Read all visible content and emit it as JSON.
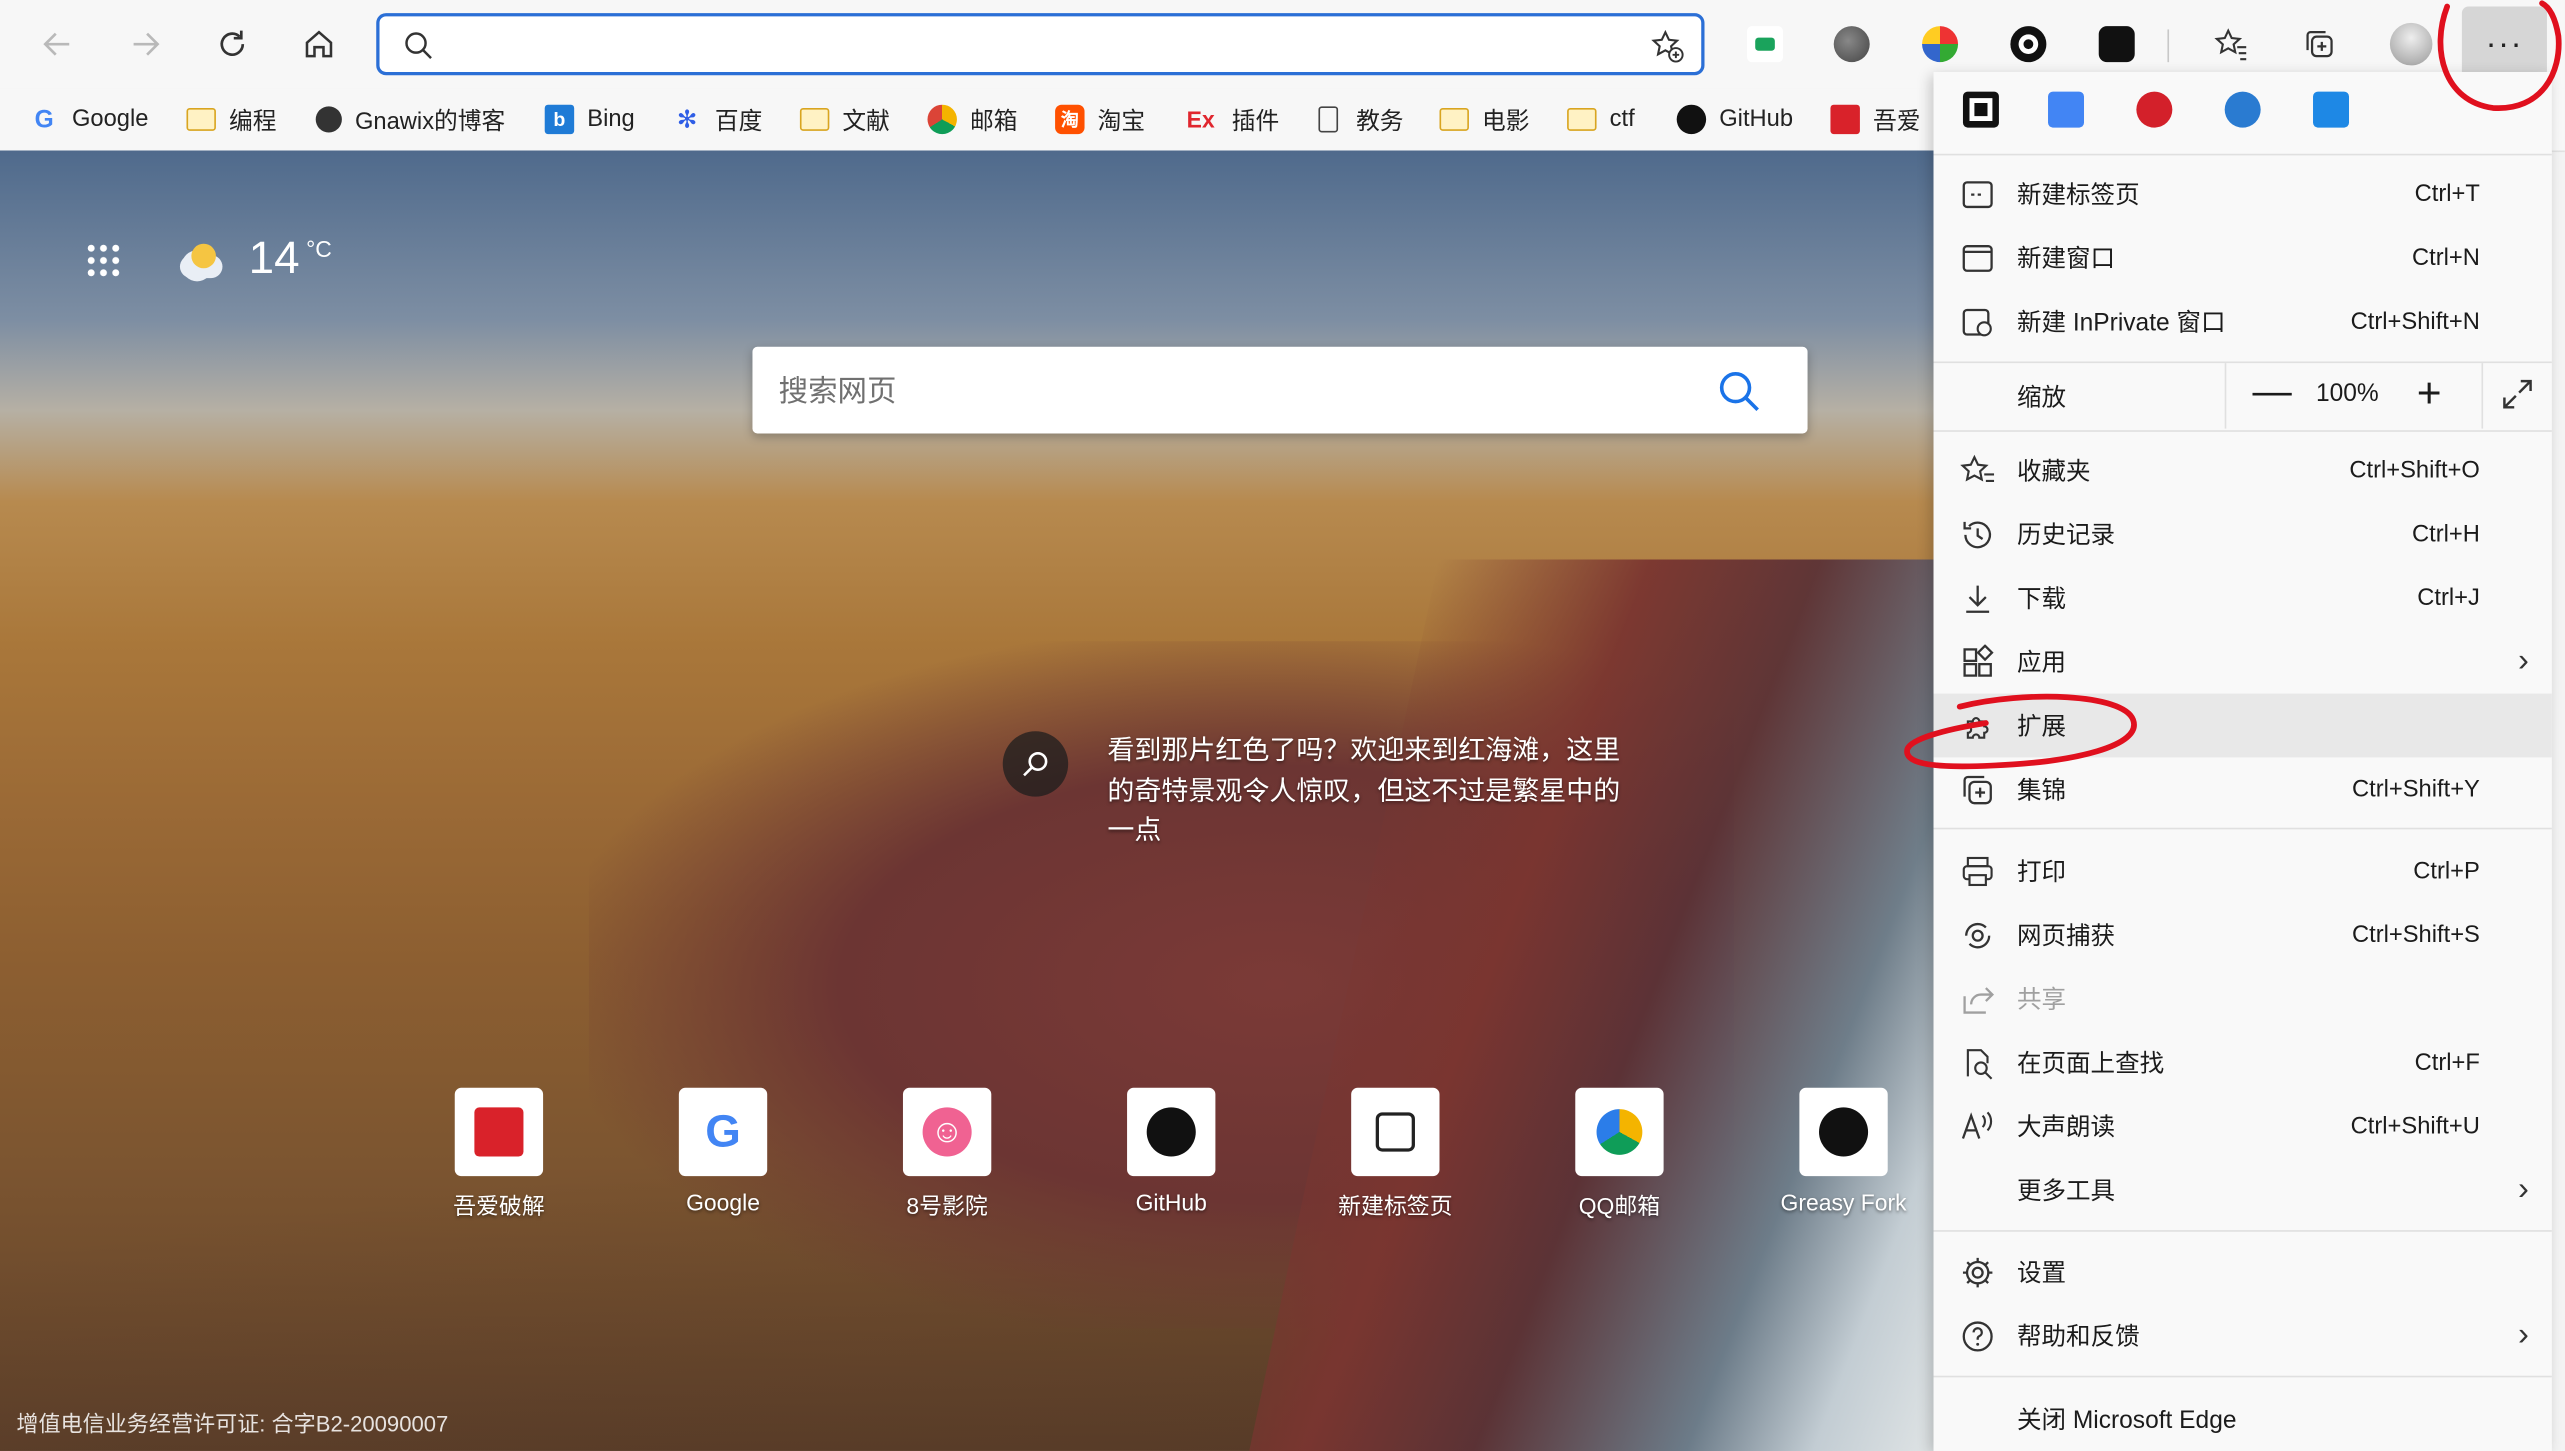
{
  "toolbar": {
    "address_value": "",
    "address_placeholder": "",
    "menu_label": "···"
  },
  "bookmarks": [
    {
      "label": "Google",
      "icon": "google-icon"
    },
    {
      "label": "编程",
      "icon": "folder-icon"
    },
    {
      "label": "Gnawix的博客",
      "icon": "avatar-icon"
    },
    {
      "label": "Bing",
      "icon": "bing-icon"
    },
    {
      "label": "百度",
      "icon": "baidu-icon"
    },
    {
      "label": "文献",
      "icon": "folder-icon"
    },
    {
      "label": "邮箱",
      "icon": "mail-icon"
    },
    {
      "label": "淘宝",
      "icon": "taobao-icon"
    },
    {
      "label": "插件",
      "icon": "ex-icon"
    },
    {
      "label": "教务",
      "icon": "page-icon"
    },
    {
      "label": "电影",
      "icon": "folder-icon"
    },
    {
      "label": "ctf",
      "icon": "folder-icon"
    },
    {
      "label": "GitHub",
      "icon": "github-icon"
    },
    {
      "label": "吾爱",
      "icon": "52pojie-icon"
    }
  ],
  "newtab": {
    "weather_temp": "14",
    "weather_unit": "°C",
    "search_placeholder": "搜索网页",
    "info_text": "看到那片红色了吗？欢迎来到红海滩，这里的奇特景观令人惊叹，但这不过是繁星中的一点",
    "tiles": [
      {
        "label": "吾爱破解",
        "icon": "52pojie-icon"
      },
      {
        "label": "Google",
        "icon": "google-icon"
      },
      {
        "label": "8号影院",
        "icon": "smile-icon"
      },
      {
        "label": "GitHub",
        "icon": "github-icon"
      },
      {
        "label": "新建标签页",
        "icon": "newtab-icon"
      },
      {
        "label": "QQ邮箱",
        "icon": "qqmail-icon"
      },
      {
        "label": "Greasy Fork",
        "icon": "greasyfork-icon"
      }
    ],
    "footer": "增值电信业务经营许可证: 合字B2-20090007"
  },
  "menu": {
    "zoom_label": "缩放",
    "zoom_value": "100%",
    "zoom_minus": "—",
    "zoom_plus": "+",
    "items": [
      {
        "label": "新建标签页",
        "shortcut": "Ctrl+T",
        "icon": "new-tab-icon"
      },
      {
        "label": "新建窗口",
        "shortcut": "Ctrl+N",
        "icon": "new-window-icon"
      },
      {
        "label": "新建 InPrivate 窗口",
        "shortcut": "Ctrl+Shift+N",
        "icon": "inprivate-icon"
      },
      {
        "label": "收藏夹",
        "shortcut": "Ctrl+Shift+O",
        "icon": "favorites-icon"
      },
      {
        "label": "历史记录",
        "shortcut": "Ctrl+H",
        "icon": "history-icon"
      },
      {
        "label": "下载",
        "shortcut": "Ctrl+J",
        "icon": "download-icon"
      },
      {
        "label": "应用",
        "shortcut": "",
        "icon": "apps-icon"
      },
      {
        "label": "扩展",
        "shortcut": "",
        "icon": "extensions-icon"
      },
      {
        "label": "集锦",
        "shortcut": "Ctrl+Shift+Y",
        "icon": "collections-icon"
      },
      {
        "label": "打印",
        "shortcut": "Ctrl+P",
        "icon": "print-icon"
      },
      {
        "label": "网页捕获",
        "shortcut": "Ctrl+Shift+S",
        "icon": "web-capture-icon"
      },
      {
        "label": "共享",
        "shortcut": "",
        "icon": "share-icon"
      },
      {
        "label": "在页面上查找",
        "shortcut": "Ctrl+F",
        "icon": "find-icon"
      },
      {
        "label": "大声朗读",
        "shortcut": "Ctrl+Shift+U",
        "icon": "read-aloud-icon"
      },
      {
        "label": "更多工具",
        "shortcut": "",
        "icon": ""
      },
      {
        "label": "设置",
        "shortcut": "",
        "icon": "settings-icon"
      },
      {
        "label": "帮助和反馈",
        "shortcut": "",
        "icon": "help-icon"
      },
      {
        "label": "关闭 Microsoft Edge",
        "shortcut": "",
        "icon": ""
      }
    ]
  },
  "colors": {
    "accent": "#2b6fd6",
    "annotation_red": "#e0101e",
    "menu_bg": "#f9f9f9"
  }
}
